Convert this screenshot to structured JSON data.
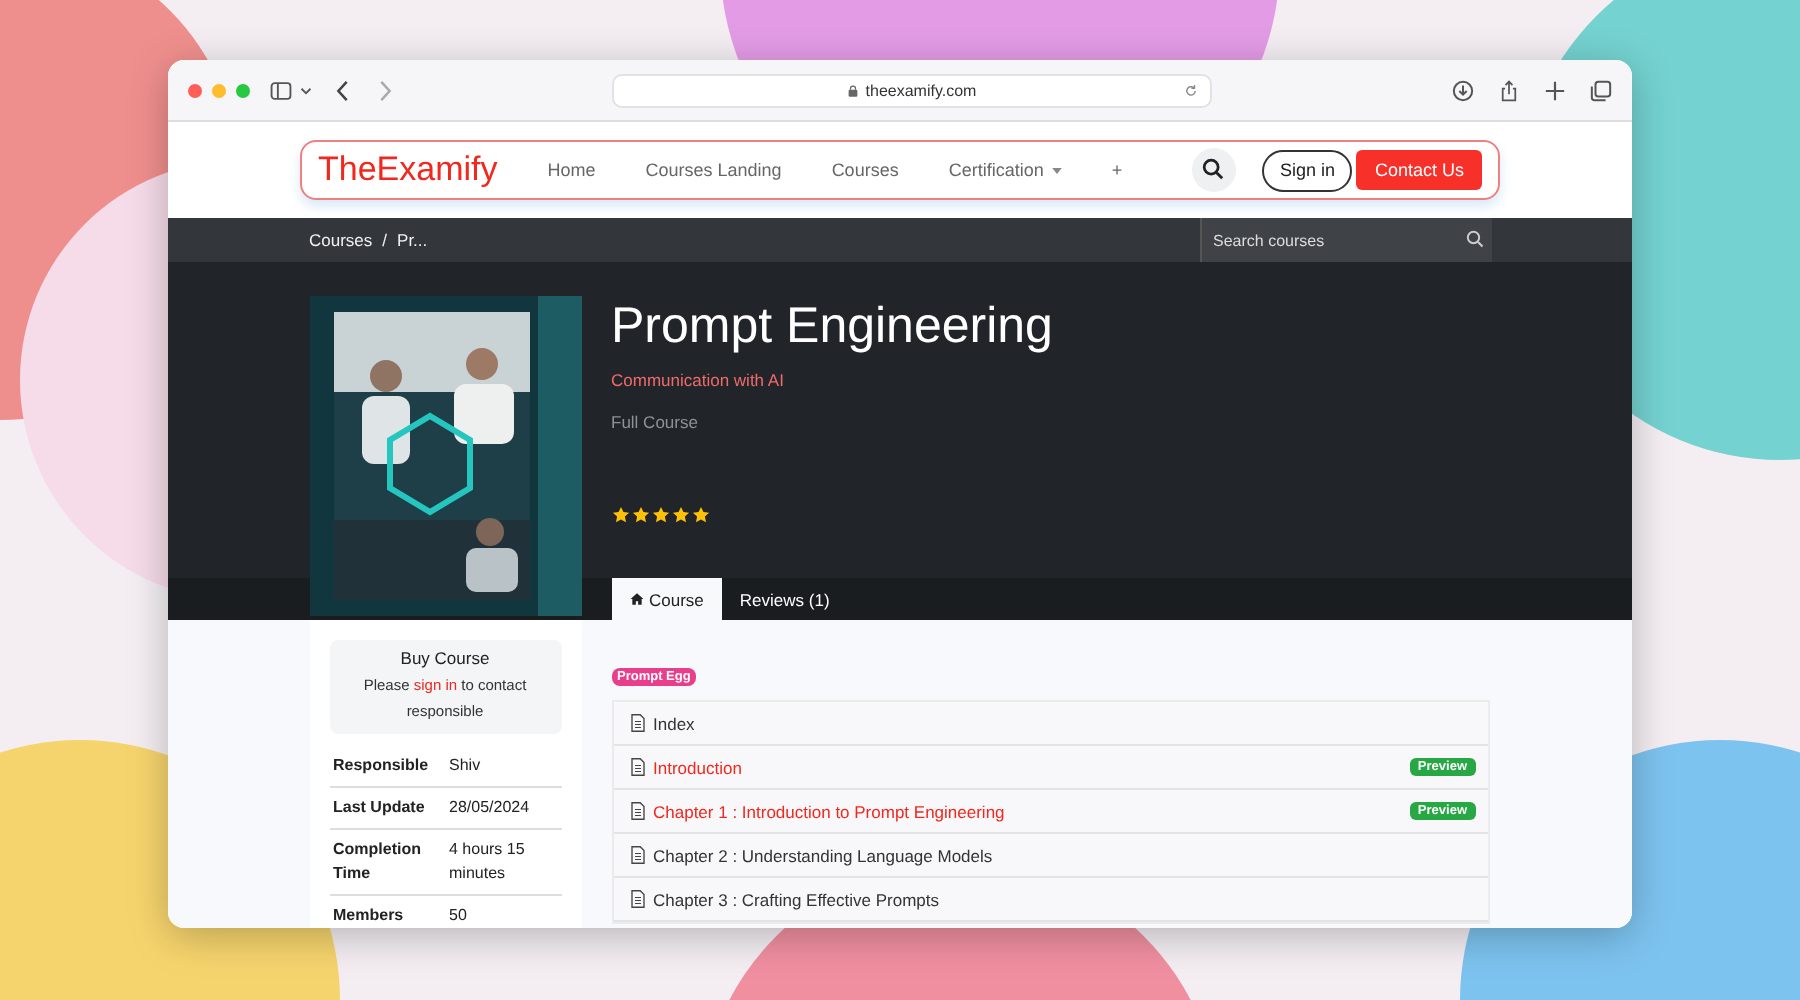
{
  "browser": {
    "url": "theexamify.com"
  },
  "navbar": {
    "brand": "TheExamify",
    "links": [
      {
        "label": "Home",
        "kind": "link"
      },
      {
        "label": "Courses Landing",
        "kind": "link"
      },
      {
        "label": "Courses",
        "kind": "link"
      },
      {
        "label": "Certification",
        "kind": "dropdown"
      },
      {
        "label": "+",
        "kind": "link"
      }
    ],
    "sign_in": "Sign in",
    "contact": "Contact Us"
  },
  "breadcrumb": {
    "items": [
      "Courses",
      "Pr..."
    ],
    "separator": "/"
  },
  "search": {
    "placeholder": "Search courses"
  },
  "course": {
    "title": "Prompt Engineering",
    "subtitle": "Communication with AI",
    "type": "Full Course",
    "stars": 5
  },
  "tabs": [
    {
      "label": "Course",
      "kind": "home",
      "selected": true
    },
    {
      "label": "Reviews (1)",
      "kind": "plain",
      "selected": false
    }
  ],
  "buy": {
    "title": "Buy Course",
    "before": "Please",
    "link": "sign in",
    "after": "to contact responsible"
  },
  "details": [
    {
      "label": "Responsible",
      "value": "Shiv"
    },
    {
      "label": "Last Update",
      "value": "28/05/2024"
    },
    {
      "label": "Completion Time",
      "value": "4 hours 15 minutes"
    },
    {
      "label": "Members",
      "value": "50"
    }
  ],
  "tag": "Prompt Egg",
  "lessons": [
    {
      "title": "Index",
      "highlighted": false
    },
    {
      "title": "Introduction",
      "highlighted": true,
      "badge": "Preview"
    },
    {
      "title": "Chapter 1 : Introduction to Prompt Engineering",
      "highlighted": true,
      "badge": "Preview"
    },
    {
      "title": "Chapter 2 : Understanding Language Models",
      "highlighted": false
    },
    {
      "title": "Chapter 3 : Crafting Effective Prompts",
      "highlighted": false
    }
  ]
}
